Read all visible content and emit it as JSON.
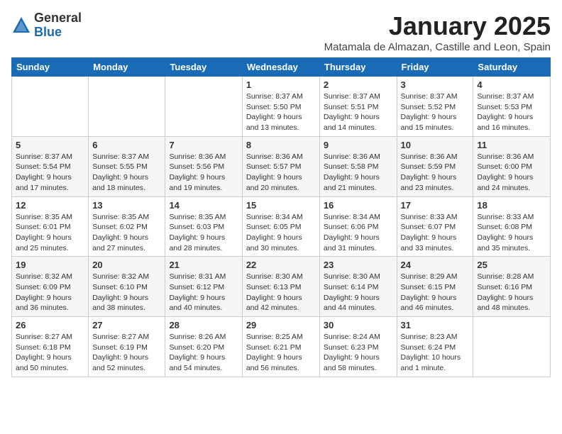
{
  "header": {
    "logo_general": "General",
    "logo_blue": "Blue",
    "month_title": "January 2025",
    "subtitle": "Matamala de Almazan, Castille and Leon, Spain"
  },
  "weekdays": [
    "Sunday",
    "Monday",
    "Tuesday",
    "Wednesday",
    "Thursday",
    "Friday",
    "Saturday"
  ],
  "weeks": [
    [
      {
        "day": "",
        "info": ""
      },
      {
        "day": "",
        "info": ""
      },
      {
        "day": "",
        "info": ""
      },
      {
        "day": "1",
        "info": "Sunrise: 8:37 AM\nSunset: 5:50 PM\nDaylight: 9 hours\nand 13 minutes."
      },
      {
        "day": "2",
        "info": "Sunrise: 8:37 AM\nSunset: 5:51 PM\nDaylight: 9 hours\nand 14 minutes."
      },
      {
        "day": "3",
        "info": "Sunrise: 8:37 AM\nSunset: 5:52 PM\nDaylight: 9 hours\nand 15 minutes."
      },
      {
        "day": "4",
        "info": "Sunrise: 8:37 AM\nSunset: 5:53 PM\nDaylight: 9 hours\nand 16 minutes."
      }
    ],
    [
      {
        "day": "5",
        "info": "Sunrise: 8:37 AM\nSunset: 5:54 PM\nDaylight: 9 hours\nand 17 minutes."
      },
      {
        "day": "6",
        "info": "Sunrise: 8:37 AM\nSunset: 5:55 PM\nDaylight: 9 hours\nand 18 minutes."
      },
      {
        "day": "7",
        "info": "Sunrise: 8:36 AM\nSunset: 5:56 PM\nDaylight: 9 hours\nand 19 minutes."
      },
      {
        "day": "8",
        "info": "Sunrise: 8:36 AM\nSunset: 5:57 PM\nDaylight: 9 hours\nand 20 minutes."
      },
      {
        "day": "9",
        "info": "Sunrise: 8:36 AM\nSunset: 5:58 PM\nDaylight: 9 hours\nand 21 minutes."
      },
      {
        "day": "10",
        "info": "Sunrise: 8:36 AM\nSunset: 5:59 PM\nDaylight: 9 hours\nand 23 minutes."
      },
      {
        "day": "11",
        "info": "Sunrise: 8:36 AM\nSunset: 6:00 PM\nDaylight: 9 hours\nand 24 minutes."
      }
    ],
    [
      {
        "day": "12",
        "info": "Sunrise: 8:35 AM\nSunset: 6:01 PM\nDaylight: 9 hours\nand 25 minutes."
      },
      {
        "day": "13",
        "info": "Sunrise: 8:35 AM\nSunset: 6:02 PM\nDaylight: 9 hours\nand 27 minutes."
      },
      {
        "day": "14",
        "info": "Sunrise: 8:35 AM\nSunset: 6:03 PM\nDaylight: 9 hours\nand 28 minutes."
      },
      {
        "day": "15",
        "info": "Sunrise: 8:34 AM\nSunset: 6:05 PM\nDaylight: 9 hours\nand 30 minutes."
      },
      {
        "day": "16",
        "info": "Sunrise: 8:34 AM\nSunset: 6:06 PM\nDaylight: 9 hours\nand 31 minutes."
      },
      {
        "day": "17",
        "info": "Sunrise: 8:33 AM\nSunset: 6:07 PM\nDaylight: 9 hours\nand 33 minutes."
      },
      {
        "day": "18",
        "info": "Sunrise: 8:33 AM\nSunset: 6:08 PM\nDaylight: 9 hours\nand 35 minutes."
      }
    ],
    [
      {
        "day": "19",
        "info": "Sunrise: 8:32 AM\nSunset: 6:09 PM\nDaylight: 9 hours\nand 36 minutes."
      },
      {
        "day": "20",
        "info": "Sunrise: 8:32 AM\nSunset: 6:10 PM\nDaylight: 9 hours\nand 38 minutes."
      },
      {
        "day": "21",
        "info": "Sunrise: 8:31 AM\nSunset: 6:12 PM\nDaylight: 9 hours\nand 40 minutes."
      },
      {
        "day": "22",
        "info": "Sunrise: 8:30 AM\nSunset: 6:13 PM\nDaylight: 9 hours\nand 42 minutes."
      },
      {
        "day": "23",
        "info": "Sunrise: 8:30 AM\nSunset: 6:14 PM\nDaylight: 9 hours\nand 44 minutes."
      },
      {
        "day": "24",
        "info": "Sunrise: 8:29 AM\nSunset: 6:15 PM\nDaylight: 9 hours\nand 46 minutes."
      },
      {
        "day": "25",
        "info": "Sunrise: 8:28 AM\nSunset: 6:16 PM\nDaylight: 9 hours\nand 48 minutes."
      }
    ],
    [
      {
        "day": "26",
        "info": "Sunrise: 8:27 AM\nSunset: 6:18 PM\nDaylight: 9 hours\nand 50 minutes."
      },
      {
        "day": "27",
        "info": "Sunrise: 8:27 AM\nSunset: 6:19 PM\nDaylight: 9 hours\nand 52 minutes."
      },
      {
        "day": "28",
        "info": "Sunrise: 8:26 AM\nSunset: 6:20 PM\nDaylight: 9 hours\nand 54 minutes."
      },
      {
        "day": "29",
        "info": "Sunrise: 8:25 AM\nSunset: 6:21 PM\nDaylight: 9 hours\nand 56 minutes."
      },
      {
        "day": "30",
        "info": "Sunrise: 8:24 AM\nSunset: 6:23 PM\nDaylight: 9 hours\nand 58 minutes."
      },
      {
        "day": "31",
        "info": "Sunrise: 8:23 AM\nSunset: 6:24 PM\nDaylight: 10 hours\nand 1 minute."
      },
      {
        "day": "",
        "info": ""
      }
    ]
  ]
}
